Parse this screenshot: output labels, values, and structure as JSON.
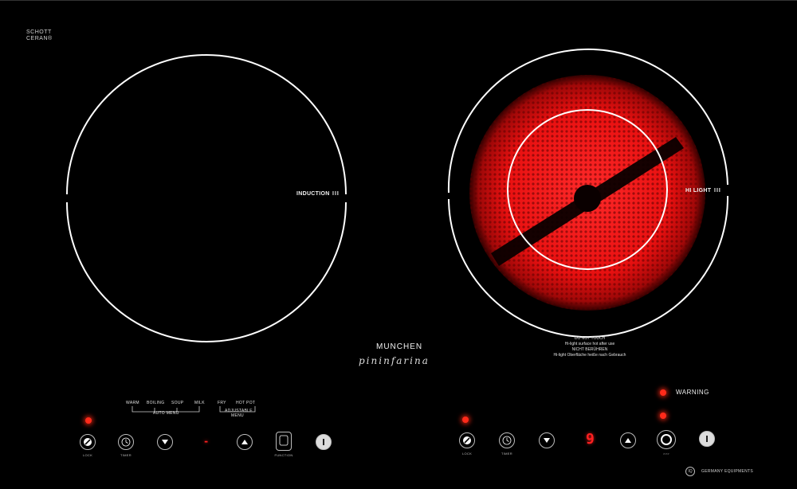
{
  "brand": {
    "schott_line1": "SCHOTT",
    "schott_line2": "CERAN®",
    "munchen": "MUNCHEN",
    "pininfarina": "pininfarina"
  },
  "left_zone": {
    "label": "INDUCTION",
    "bars": "III"
  },
  "right_zone": {
    "label": "HI LIGHT",
    "bars": "III",
    "heating": true,
    "glow_color": "#ff1a1a"
  },
  "warning_text": [
    "DO NOT TOUCH",
    "Hi-light surface hot after use",
    "NICHT BERÜHREN",
    "Hi-light Oberfläche heiße nach Gebrauch"
  ],
  "auto_menu": {
    "items": [
      "WARM",
      "BOILING",
      "SOUP",
      "MILK"
    ],
    "label": "AUTO MENU"
  },
  "adjustable_menu": {
    "items": [
      "FRY",
      "HOT POT"
    ],
    "label_line1": "ADJUSTABLE",
    "label_line2": "MENU"
  },
  "left_controls": {
    "lock_label": "LOCK",
    "timer_label": "TIMER",
    "function_label": "FUNCTION",
    "display": "-"
  },
  "right_controls": {
    "lock_label": "LOCK",
    "timer_label": "TIMER",
    "boost_label": ">>>",
    "display": "9"
  },
  "warning_indicator": "WARNING",
  "footer": {
    "iq": "IQ",
    "company": "GERMANY EQUIPMENTS"
  },
  "colors": {
    "background": "#000000",
    "led": "#ff2a1a",
    "ring": "#ffffff"
  }
}
